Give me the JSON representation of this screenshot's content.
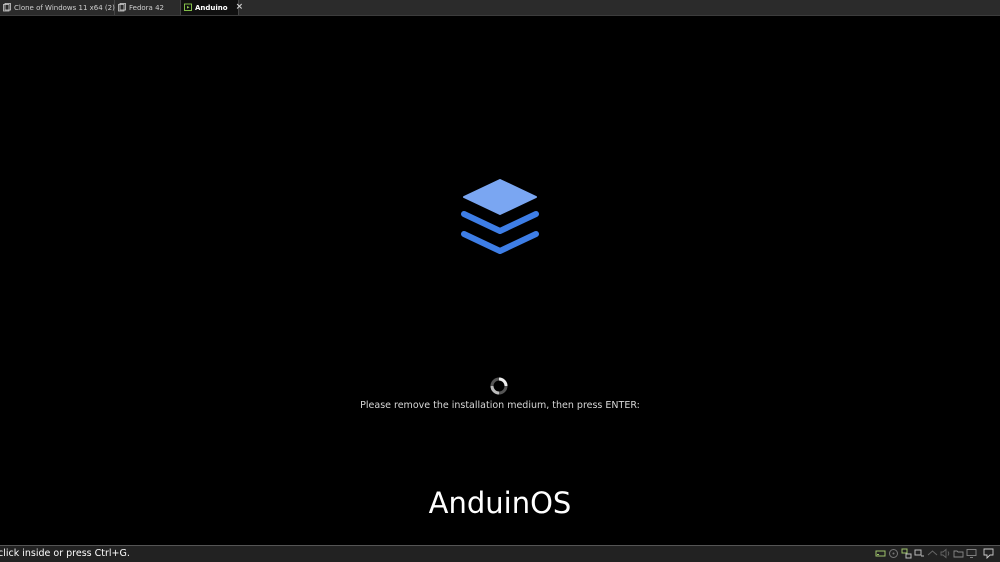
{
  "tabs": [
    {
      "label": "Clone of Windows 11 x64 (2)",
      "close": "×",
      "active": false,
      "icon": "vm-icon"
    },
    {
      "label": "Fedora 42",
      "close": "",
      "active": false,
      "icon": "vm-icon"
    },
    {
      "label": "Anduino",
      "close": "×",
      "active": true,
      "icon": "vm-running-icon"
    }
  ],
  "vm_screen": {
    "logo": "anduinos-stacked-layers-logo",
    "message": "Please remove the installation medium, then press ENTER:",
    "brand": "AnduinOS",
    "logo_colors": {
      "top": "#7aa6f2",
      "bottom": "#3e7ee6"
    }
  },
  "statusbar": {
    "text": "click inside or press Ctrl+G.",
    "icons": [
      "hard-disk-icon",
      "optical-drive-icon",
      "network-icon",
      "network-icon-2",
      "usb-icon",
      "sound-icon",
      "shared-folder-icon",
      "display-icon",
      "message-icon"
    ]
  }
}
